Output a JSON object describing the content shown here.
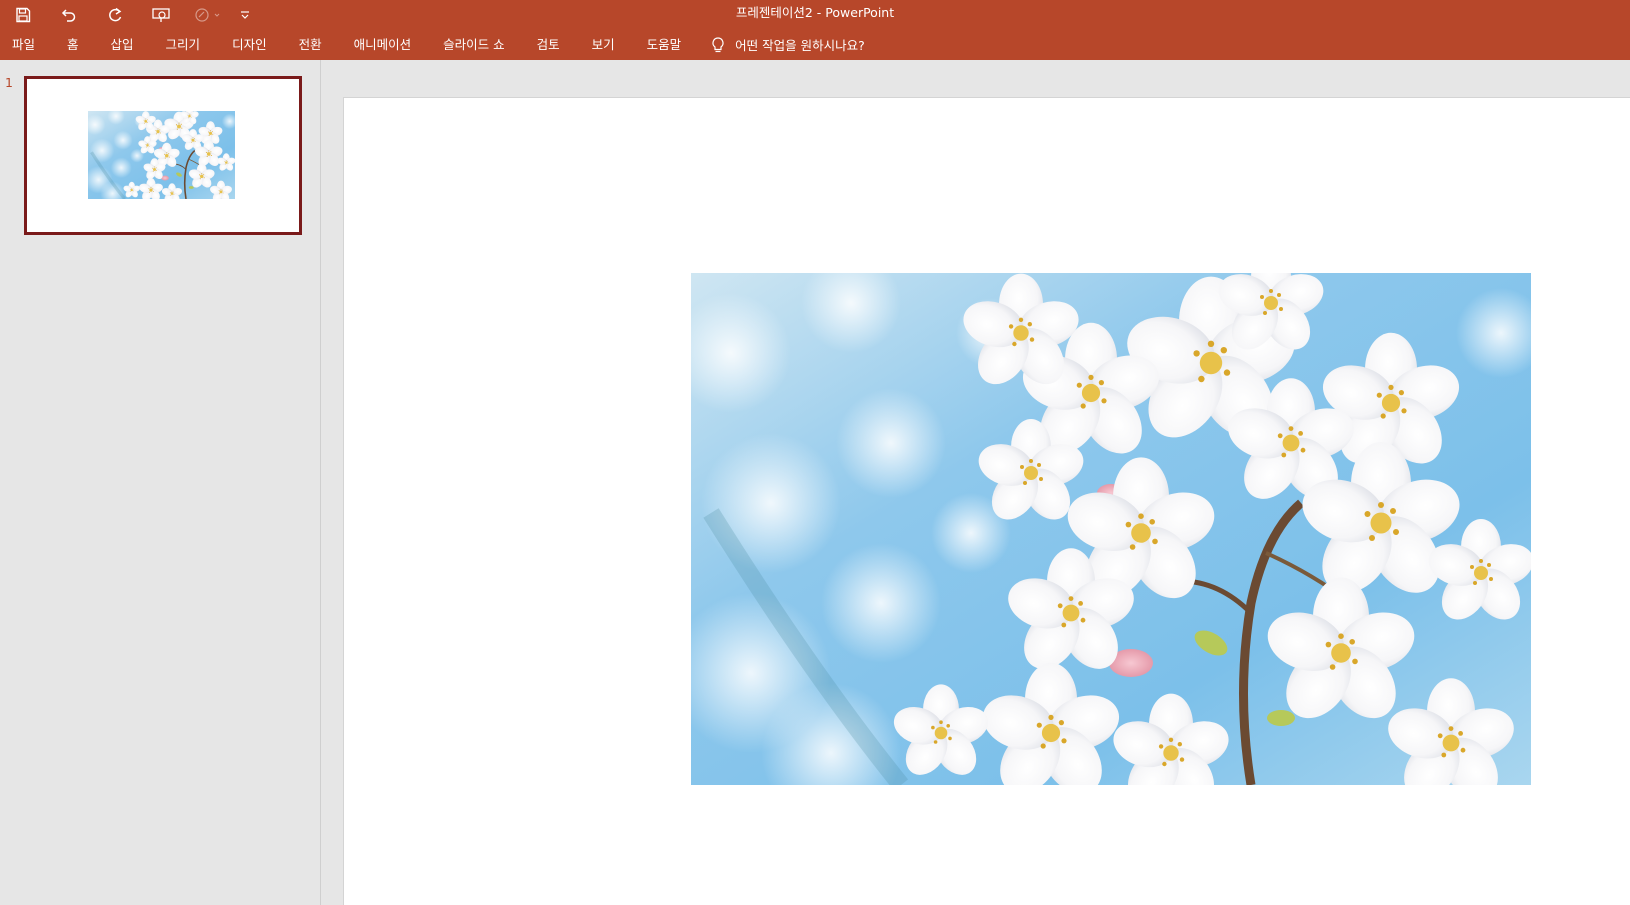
{
  "window": {
    "title": "프레젠테이션2  -  PowerPoint"
  },
  "quick_access": {
    "icons": [
      "save-icon",
      "undo-icon",
      "redo-icon",
      "start-from-beginning-icon",
      "touch-mode-icon",
      "customize-qat-icon"
    ]
  },
  "ribbon": {
    "tabs": [
      {
        "label": "파일"
      },
      {
        "label": "홈"
      },
      {
        "label": "삽입"
      },
      {
        "label": "그리기"
      },
      {
        "label": "디자인"
      },
      {
        "label": "전환"
      },
      {
        "label": "애니메이션"
      },
      {
        "label": "슬라이드 쇼"
      },
      {
        "label": "검토"
      },
      {
        "label": "보기"
      },
      {
        "label": "도움말"
      }
    ],
    "tell_me": {
      "icon": "lightbulb-icon",
      "placeholder": "어떤 작업을 원하시나요?"
    }
  },
  "thumbnails": {
    "slides": [
      {
        "number": "1",
        "selected": true
      }
    ]
  },
  "colors": {
    "accent": "#b7472a",
    "selection_border": "#7a1a1a",
    "workspace": "#e6e6e6"
  }
}
